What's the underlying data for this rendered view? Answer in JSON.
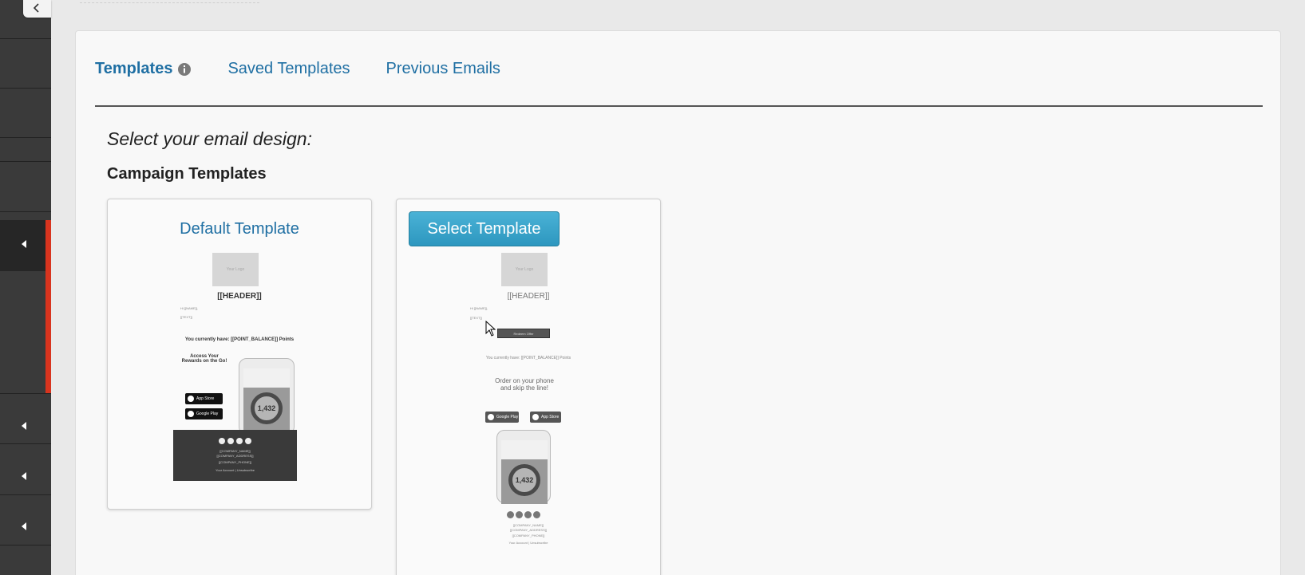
{
  "sidebar": {
    "collapse_icon": "chevron-left-icon",
    "arrow_icons": [
      "caret-left-icon",
      "caret-left-icon",
      "caret-left-icon",
      "caret-left-icon"
    ]
  },
  "tabs": [
    {
      "label": "Templates",
      "active": true,
      "has_info": true
    },
    {
      "label": "Saved Templates",
      "active": false
    },
    {
      "label": "Previous Emails",
      "active": false
    }
  ],
  "main": {
    "prompt": "Select your email design:",
    "section_title": "Campaign Templates"
  },
  "cards": [
    {
      "title": "Default Template",
      "preview": {
        "logo": "Your Logo",
        "header": "[[HEADER]]",
        "line1": "Hi [[NAME]],",
        "line2": "[[TEXT]]",
        "balance": "You currently have: [[POINT_BALANCE]] Points",
        "promo_title": "Access Your Rewards on the Go!",
        "app_store": "App Store",
        "google_play": "Google Play",
        "gauge_value": "1,432",
        "footer_line1": "[[COMPANY_NAME]]",
        "footer_line2": "[[COMPANY_ADDRESS]]",
        "footer_line3": "[[COMPANY_PHONE]]",
        "footer_links": "Your Account | Unsubscribe"
      }
    },
    {
      "button_label": "Select Template",
      "preview": {
        "logo": "Your Logo",
        "header": "[[HEADER]]",
        "line1": "Hi [[NAME]],",
        "line2": "[[TEXT]]",
        "button_text": "Redeem Offer",
        "balance": "You currently have: [[POINT_BALANCE]] Points",
        "promo_title": "Order on your phone and skip the line!",
        "google_play": "Google Play",
        "app_store": "App Store",
        "gauge_value": "1,432",
        "footer_line1": "[[COMPANY_NAME]]",
        "footer_line2": "[[COMPANY_ADDRESS]]",
        "footer_line3": "[[COMPANY_PHONE]]",
        "footer_links": "Your Account | Unsubscribe"
      }
    }
  ],
  "colors": {
    "link": "#1f6fa3",
    "accent_red": "#d8341e",
    "button": "#3aa5cc",
    "sidebar": "#3a3a3a"
  }
}
